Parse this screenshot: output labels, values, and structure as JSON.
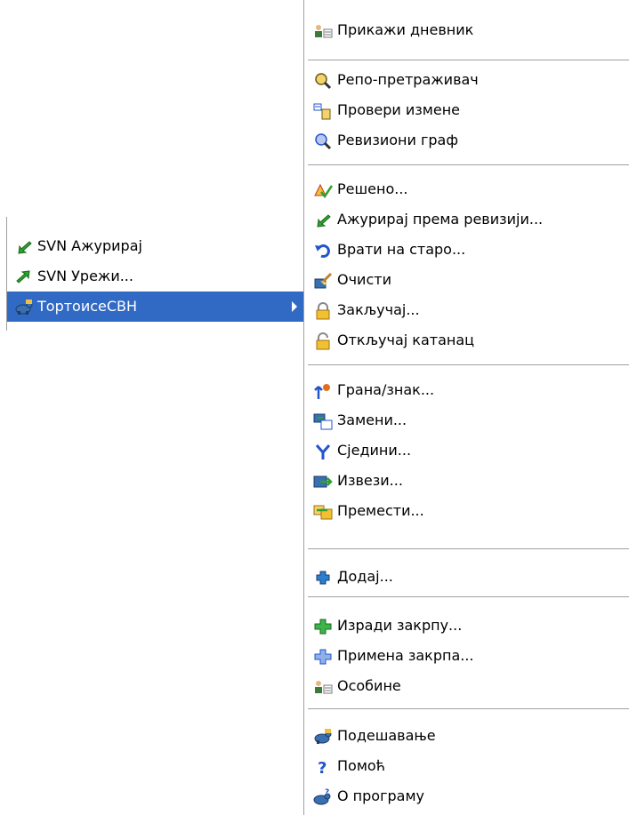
{
  "main_menu": {
    "items": [
      {
        "label": "SVN Ажурирај",
        "icon": "svn-update-icon"
      },
      {
        "label": "SVN Урежи...",
        "icon": "svn-commit-icon"
      },
      {
        "label": "ТортоисеСВН",
        "icon": "tortoisesvn-icon",
        "selected": true,
        "has_submenu": true
      }
    ]
  },
  "submenu": {
    "show_log": "Прикажи дневник",
    "repo_browser": "Репо-претраживач",
    "check_modifications": "Провери измене",
    "revision_graph": "Ревизиони граф",
    "resolved": "Решено...",
    "update_to_revision": "Ажурирај према ревизији...",
    "revert": "Врати на старо...",
    "cleanup": "Очисти",
    "lock": "Закључај...",
    "unlock": "Откључај катанац",
    "branch_tag": "Грана/знак...",
    "switch": "Замени...",
    "merge": "Сједини...",
    "export": "Извези...",
    "relocate": "Премести...",
    "add": "Додај...",
    "create_patch": "Изради закрпу...",
    "apply_patch": "Примена закрпа...",
    "properties": "Особине",
    "settings": "Подешавање",
    "help": "Помоћ",
    "about": "О програму"
  },
  "colors": {
    "selection": "#316ac5",
    "separator": "#a0a0a0",
    "green_arrow": "#2fa12f",
    "blue": "#2255cc"
  }
}
